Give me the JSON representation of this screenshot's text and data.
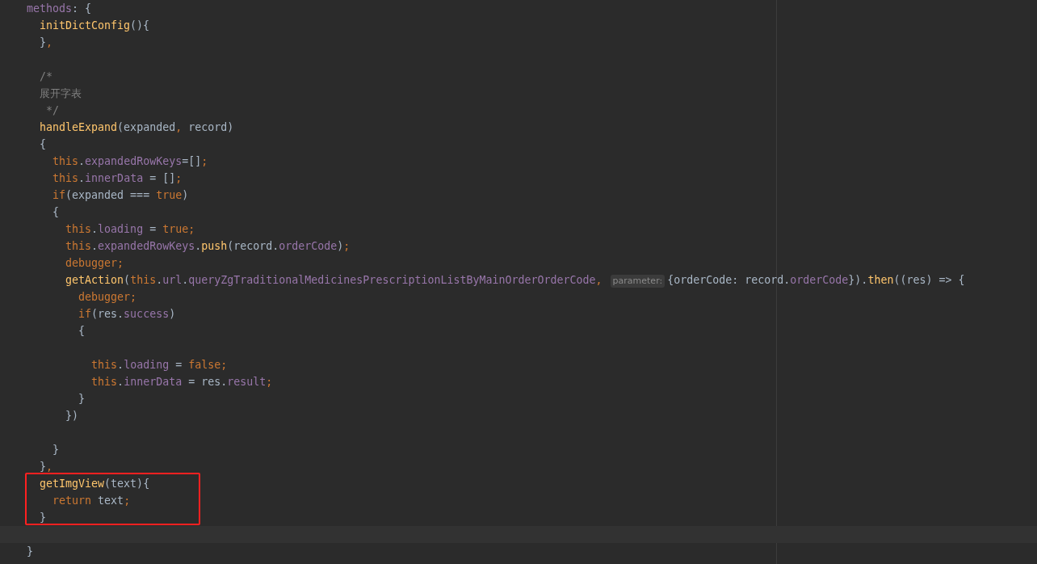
{
  "editor": {
    "lines": [
      {
        "boxed": false,
        "tokens": [
          {
            "kind": "property",
            "text": "  methods"
          },
          {
            "kind": "plain",
            "text": ": {"
          }
        ]
      },
      {
        "boxed": false,
        "tokens": [
          {
            "kind": "function",
            "text": "    initDictConfig"
          },
          {
            "kind": "plain",
            "text": "(){"
          }
        ]
      },
      {
        "boxed": false,
        "tokens": [
          {
            "kind": "plain",
            "text": "    }"
          },
          {
            "kind": "keyword",
            "text": ","
          }
        ]
      },
      {
        "boxed": false
      },
      {
        "boxed": false,
        "tokens": [
          {
            "kind": "comment",
            "text": "    /*"
          }
        ]
      },
      {
        "boxed": false,
        "tokens": [
          {
            "kind": "comment",
            "text": "    展开字表"
          }
        ]
      },
      {
        "boxed": false,
        "tokens": [
          {
            "kind": "comment",
            "text": "     */"
          }
        ]
      },
      {
        "boxed": false,
        "tokens": [
          {
            "kind": "function",
            "text": "    handleExpand"
          },
          {
            "kind": "plain",
            "text": "(expanded"
          },
          {
            "kind": "keyword",
            "text": ","
          },
          {
            "kind": "plain",
            "text": " record)"
          }
        ]
      },
      {
        "boxed": false,
        "tokens": [
          {
            "kind": "plain",
            "text": "    {"
          }
        ]
      },
      {
        "boxed": false,
        "tokens": [
          {
            "kind": "keyword",
            "text": "      this"
          },
          {
            "kind": "plain",
            "text": "."
          },
          {
            "kind": "property",
            "text": "expandedRowKeys"
          },
          {
            "kind": "plain",
            "text": "=[]"
          },
          {
            "kind": "keyword",
            "text": ";"
          }
        ]
      },
      {
        "boxed": false,
        "tokens": [
          {
            "kind": "keyword",
            "text": "      this"
          },
          {
            "kind": "plain",
            "text": "."
          },
          {
            "kind": "property",
            "text": "innerData"
          },
          {
            "kind": "plain",
            "text": " = []"
          },
          {
            "kind": "keyword",
            "text": ";"
          }
        ]
      },
      {
        "boxed": false,
        "tokens": [
          {
            "kind": "keyword",
            "text": "      if"
          },
          {
            "kind": "plain",
            "text": "(expanded === "
          },
          {
            "kind": "keyword",
            "text": "true"
          },
          {
            "kind": "plain",
            "text": ")"
          }
        ]
      },
      {
        "boxed": false,
        "tokens": [
          {
            "kind": "plain",
            "text": "      {"
          }
        ]
      },
      {
        "boxed": false,
        "tokens": [
          {
            "kind": "keyword",
            "text": "        this"
          },
          {
            "kind": "plain",
            "text": "."
          },
          {
            "kind": "property",
            "text": "loading"
          },
          {
            "kind": "plain",
            "text": " = "
          },
          {
            "kind": "keyword",
            "text": "true;"
          }
        ]
      },
      {
        "boxed": false,
        "tokens": [
          {
            "kind": "keyword",
            "text": "        this"
          },
          {
            "kind": "plain",
            "text": "."
          },
          {
            "kind": "property",
            "text": "expandedRowKeys"
          },
          {
            "kind": "plain",
            "text": "."
          },
          {
            "kind": "function",
            "text": "push"
          },
          {
            "kind": "plain",
            "text": "(record."
          },
          {
            "kind": "property",
            "text": "orderCode"
          },
          {
            "kind": "plain",
            "text": ")"
          },
          {
            "kind": "keyword",
            "text": ";"
          }
        ]
      },
      {
        "boxed": false,
        "tokens": [
          {
            "kind": "keyword",
            "text": "        debugger;"
          }
        ]
      },
      {
        "boxed": false,
        "tokens": [
          {
            "kind": "function",
            "text": "        getAction"
          },
          {
            "kind": "plain",
            "text": "("
          },
          {
            "kind": "keyword",
            "text": "this"
          },
          {
            "kind": "plain",
            "text": "."
          },
          {
            "kind": "property",
            "text": "url"
          },
          {
            "kind": "plain",
            "text": "."
          },
          {
            "kind": "property",
            "text": "queryZgTraditionalMedicinesPrescriptionListByMainOrderOrderCode"
          },
          {
            "kind": "keyword",
            "text": ","
          },
          {
            "kind": "hint",
            "text": "parameter:"
          },
          {
            "kind": "plain",
            "text": "{orderCode: record."
          },
          {
            "kind": "property",
            "text": "orderCode"
          },
          {
            "kind": "plain",
            "text": "})."
          },
          {
            "kind": "function",
            "text": "then"
          },
          {
            "kind": "plain",
            "text": "((res) => {"
          }
        ]
      },
      {
        "boxed": false,
        "tokens": [
          {
            "kind": "keyword",
            "text": "          debugger;"
          }
        ]
      },
      {
        "boxed": false,
        "tokens": [
          {
            "kind": "keyword",
            "text": "          if"
          },
          {
            "kind": "plain",
            "text": "(res."
          },
          {
            "kind": "property",
            "text": "success"
          },
          {
            "kind": "plain",
            "text": ")"
          }
        ]
      },
      {
        "boxed": false,
        "tokens": [
          {
            "kind": "plain",
            "text": "          {"
          }
        ]
      },
      {
        "boxed": false
      },
      {
        "boxed": false,
        "tokens": [
          {
            "kind": "keyword",
            "text": "            this"
          },
          {
            "kind": "plain",
            "text": "."
          },
          {
            "kind": "property",
            "text": "loading"
          },
          {
            "kind": "plain",
            "text": " = "
          },
          {
            "kind": "keyword",
            "text": "false;"
          }
        ]
      },
      {
        "boxed": false,
        "tokens": [
          {
            "kind": "keyword",
            "text": "            this"
          },
          {
            "kind": "plain",
            "text": "."
          },
          {
            "kind": "property",
            "text": "innerData"
          },
          {
            "kind": "plain",
            "text": " = res."
          },
          {
            "kind": "property",
            "text": "result"
          },
          {
            "kind": "keyword",
            "text": ";"
          }
        ]
      },
      {
        "boxed": false,
        "tokens": [
          {
            "kind": "plain",
            "text": "          }"
          }
        ]
      },
      {
        "boxed": false,
        "tokens": [
          {
            "kind": "plain",
            "text": "        })"
          }
        ]
      },
      {
        "boxed": false
      },
      {
        "boxed": false,
        "tokens": [
          {
            "kind": "plain",
            "text": "      }"
          }
        ]
      },
      {
        "boxed": false,
        "tokens": [
          {
            "kind": "plain",
            "text": "    }"
          },
          {
            "kind": "keyword",
            "text": ","
          }
        ]
      },
      {
        "boxed": true,
        "tokens": [
          {
            "kind": "function",
            "text": "    getImgView"
          },
          {
            "kind": "plain",
            "text": "(text){"
          }
        ]
      },
      {
        "boxed": true,
        "tokens": [
          {
            "kind": "keyword",
            "text": "      return"
          },
          {
            "kind": "plain",
            "text": " text"
          },
          {
            "kind": "keyword",
            "text": ";"
          }
        ]
      },
      {
        "boxed": true,
        "tokens": [
          {
            "kind": "plain",
            "text": "    }"
          }
        ]
      },
      {
        "boxed": false,
        "current": true
      },
      {
        "boxed": false,
        "tokens": [
          {
            "kind": "plain",
            "text": "  }"
          }
        ]
      }
    ]
  }
}
